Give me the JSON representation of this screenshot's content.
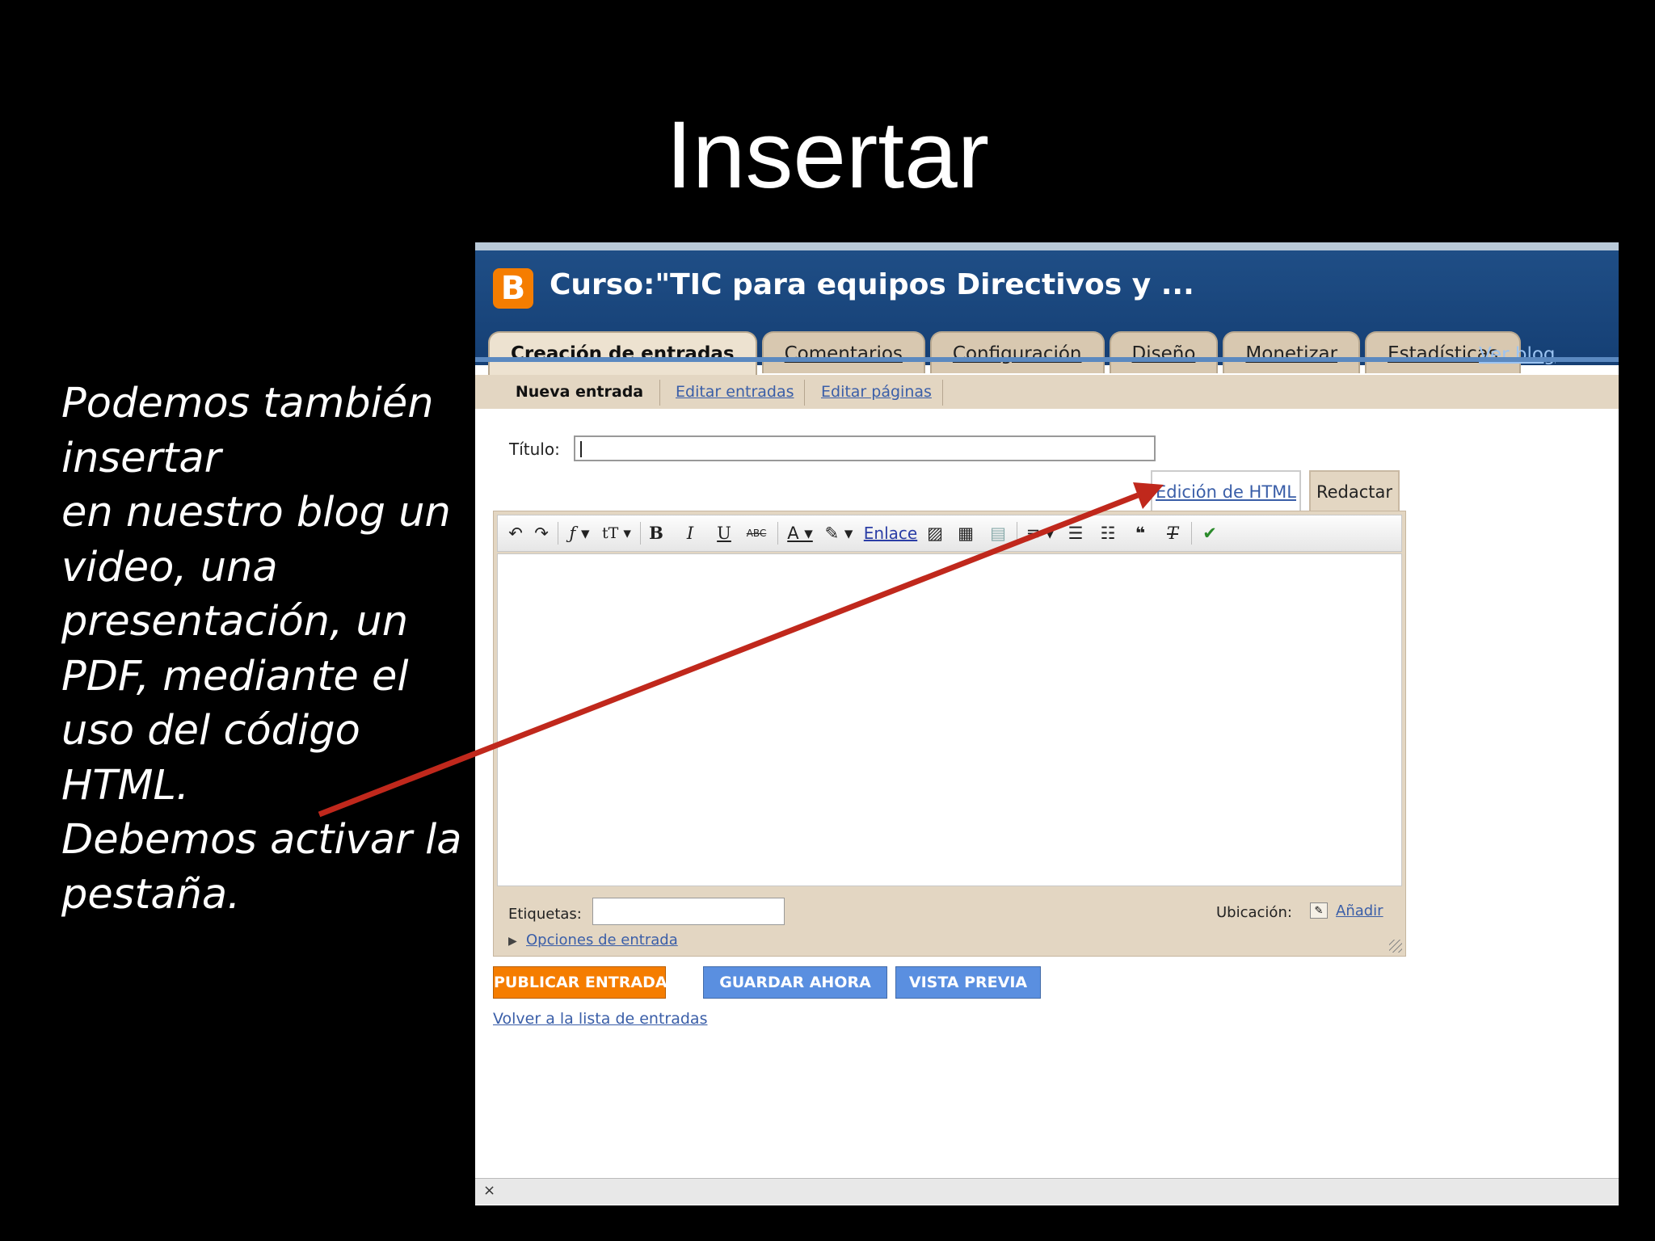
{
  "slide": {
    "title": "Insertar",
    "body_lines": [
      "Podemos también",
      "insertar",
      "en nuestro blog un",
      "video, una",
      "presentación, un",
      "PDF, mediante el",
      "uso del código",
      "HTML.",
      "Debemos activar la",
      "pestaña."
    ]
  },
  "blogger": {
    "logo_letter": "B",
    "blog_title": "Curso:\"TIC para equipos Directivos y ...",
    "tabs": [
      {
        "label": "Creación de entradas",
        "active": true
      },
      {
        "label": "Comentarios"
      },
      {
        "label": "Configuración"
      },
      {
        "label": "Diseño"
      },
      {
        "label": "Monetizar"
      },
      {
        "label": "Estadísticas"
      }
    ],
    "ver_blog": "Ver blog",
    "subnav": {
      "active": "Nueva entrada",
      "links": [
        "Editar entradas",
        "Editar páginas"
      ]
    },
    "titulo_label": "Título:",
    "mode_tabs": {
      "html": "Edición de HTML",
      "compose": "Redactar"
    },
    "toolbar": {
      "link_label": "Enlace",
      "bold": "B",
      "italic": "I",
      "underline": "U",
      "spell_label": "ABC"
    },
    "etiquetas_label": "Etiquetas:",
    "ubicacion_label": "Ubicación:",
    "anadir_link": "Añadir",
    "opciones_link": "Opciones de entrada",
    "buttons": {
      "publish": "PUBLICAR ENTRADA",
      "save": "GUARDAR AHORA",
      "preview": "VISTA PREVIA"
    },
    "volver_link": "Volver a la lista de entradas",
    "colors": {
      "header": "#1f4e86",
      "publish": "#f57d00",
      "secondary": "#5a8fe0",
      "arrow": "#c0281c"
    }
  }
}
